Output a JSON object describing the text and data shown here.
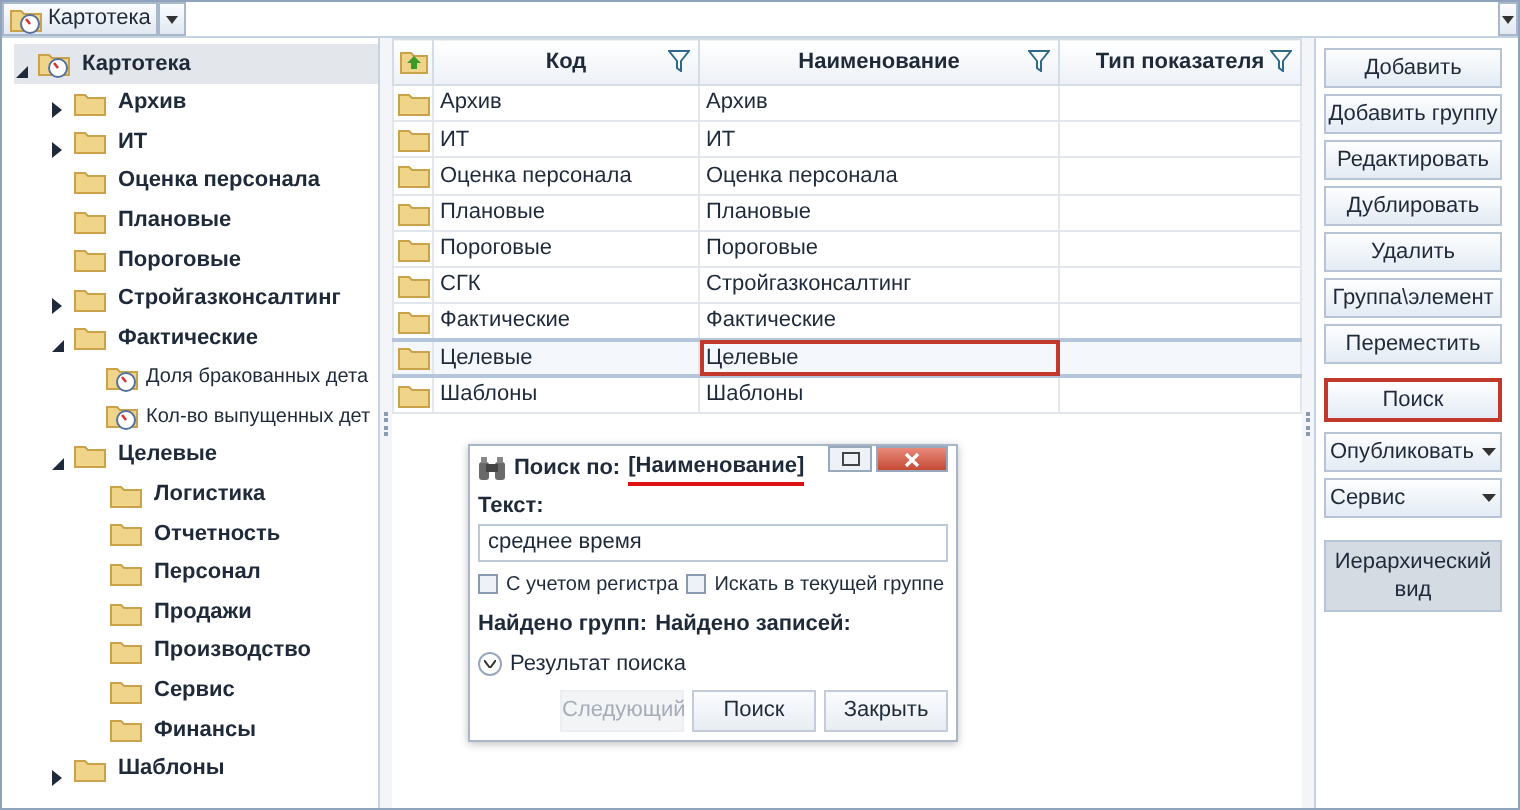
{
  "top_bar": {
    "catalog": "Картотека"
  },
  "tree": [
    {
      "label": "Картотека",
      "kind": "catalog",
      "selected": true,
      "expanded": true,
      "children": [
        {
          "label": "Архив",
          "kind": "folder",
          "selected": false,
          "expanded": false
        },
        {
          "label": "ИТ",
          "kind": "folder",
          "selected": false,
          "expanded": false
        },
        {
          "label": "Оценка персонала",
          "kind": "folder",
          "selected": false
        },
        {
          "label": "Плановые",
          "kind": "folder",
          "selected": false
        },
        {
          "label": "Пороговые",
          "kind": "folder",
          "selected": false
        },
        {
          "label": "Стройгазконсалтинг",
          "kind": "folder",
          "selected": false,
          "expanded": false
        },
        {
          "label": "Фактические",
          "kind": "folder",
          "selected": false,
          "expanded": true,
          "children": [
            {
              "label": "Доля бракованных дета",
              "kind": "indicator",
              "selected": false
            },
            {
              "label": "Кол-во выпущенных дет",
              "kind": "indicator",
              "selected": false
            }
          ]
        },
        {
          "label": "Целевые",
          "kind": "folder",
          "selected": false,
          "expanded": true,
          "children": [
            {
              "label": "Логистика",
              "kind": "folder",
              "selected": false
            },
            {
              "label": "Отчетность",
              "kind": "folder",
              "selected": false
            },
            {
              "label": "Персонал",
              "kind": "folder",
              "selected": false
            },
            {
              "label": "Продажи",
              "kind": "folder",
              "selected": false
            },
            {
              "label": "Производство",
              "kind": "folder",
              "selected": false
            },
            {
              "label": "Сервис",
              "kind": "folder",
              "selected": false
            },
            {
              "label": "Финансы",
              "kind": "folder",
              "selected": false
            }
          ]
        },
        {
          "label": "Шаблоны",
          "kind": "folder",
          "selected": false,
          "expanded": false
        }
      ]
    }
  ],
  "table": {
    "columns": [
      "Код",
      "Наименование",
      "Тип показателя"
    ],
    "rows": [
      {
        "code": "Архив",
        "name": "Архив",
        "selected": false,
        "highlighted": false
      },
      {
        "code": "ИТ",
        "name": "ИТ",
        "selected": false,
        "highlighted": false
      },
      {
        "code": "Оценка персонала",
        "name": "Оценка персонала",
        "selected": false,
        "highlighted": false
      },
      {
        "code": "Плановые",
        "name": "Плановые",
        "selected": false,
        "highlighted": false
      },
      {
        "code": "Пороговые",
        "name": "Пороговые",
        "selected": false,
        "highlighted": false
      },
      {
        "code": "СГК",
        "name": "Стройгазконсалтинг",
        "selected": false,
        "highlighted": false
      },
      {
        "code": "Фактические",
        "name": "Фактические",
        "selected": false,
        "highlighted": false
      },
      {
        "code": "Целевые",
        "name": "Целевые",
        "selected": true,
        "highlighted": true
      },
      {
        "code": "Шаблоны",
        "name": "Шаблоны",
        "selected": false,
        "highlighted": false
      }
    ]
  },
  "buttons": [
    {
      "label": "Добавить",
      "kind": "plain",
      "highlighted": false
    },
    {
      "label": "Добавить группу",
      "kind": "plain",
      "highlighted": false
    },
    {
      "label": "Редактировать",
      "kind": "plain",
      "highlighted": false
    },
    {
      "label": "Дублировать",
      "kind": "plain",
      "highlighted": false
    },
    {
      "label": "Удалить",
      "kind": "plain",
      "highlighted": false
    },
    {
      "label": "Группа\\элемент",
      "kind": "plain",
      "highlighted": false
    },
    {
      "label": "Переместить",
      "kind": "plain",
      "highlighted": false
    },
    {
      "label": "Поиск",
      "kind": "plain",
      "highlighted": true
    },
    {
      "label": "Опубликовать",
      "kind": "dropdown",
      "highlighted": false
    },
    {
      "label": "Сервис",
      "kind": "dropdown",
      "highlighted": false
    },
    {
      "label": "Иерархический вид",
      "kind": "toggle",
      "highlighted": false,
      "pressed": true
    }
  ],
  "search_dialog": {
    "title": "Поиск по:",
    "field": "[Наименование]",
    "field_underlined": true,
    "text_label": "Текст:",
    "text_value": "среднее время",
    "options": [
      {
        "label": "С учетом регистра",
        "checked": false
      },
      {
        "label": "Искать в текущей группе",
        "checked": false
      }
    ],
    "found_groups": "Найдено групп:",
    "found_records": "Найдено записей:",
    "results": {
      "label": "Результат поиска",
      "expanded": false
    },
    "buttons": [
      {
        "label": "Следующий",
        "disabled": true
      },
      {
        "label": "Поиск",
        "disabled": false
      },
      {
        "label": "Закрыть",
        "disabled": false
      }
    ]
  }
}
